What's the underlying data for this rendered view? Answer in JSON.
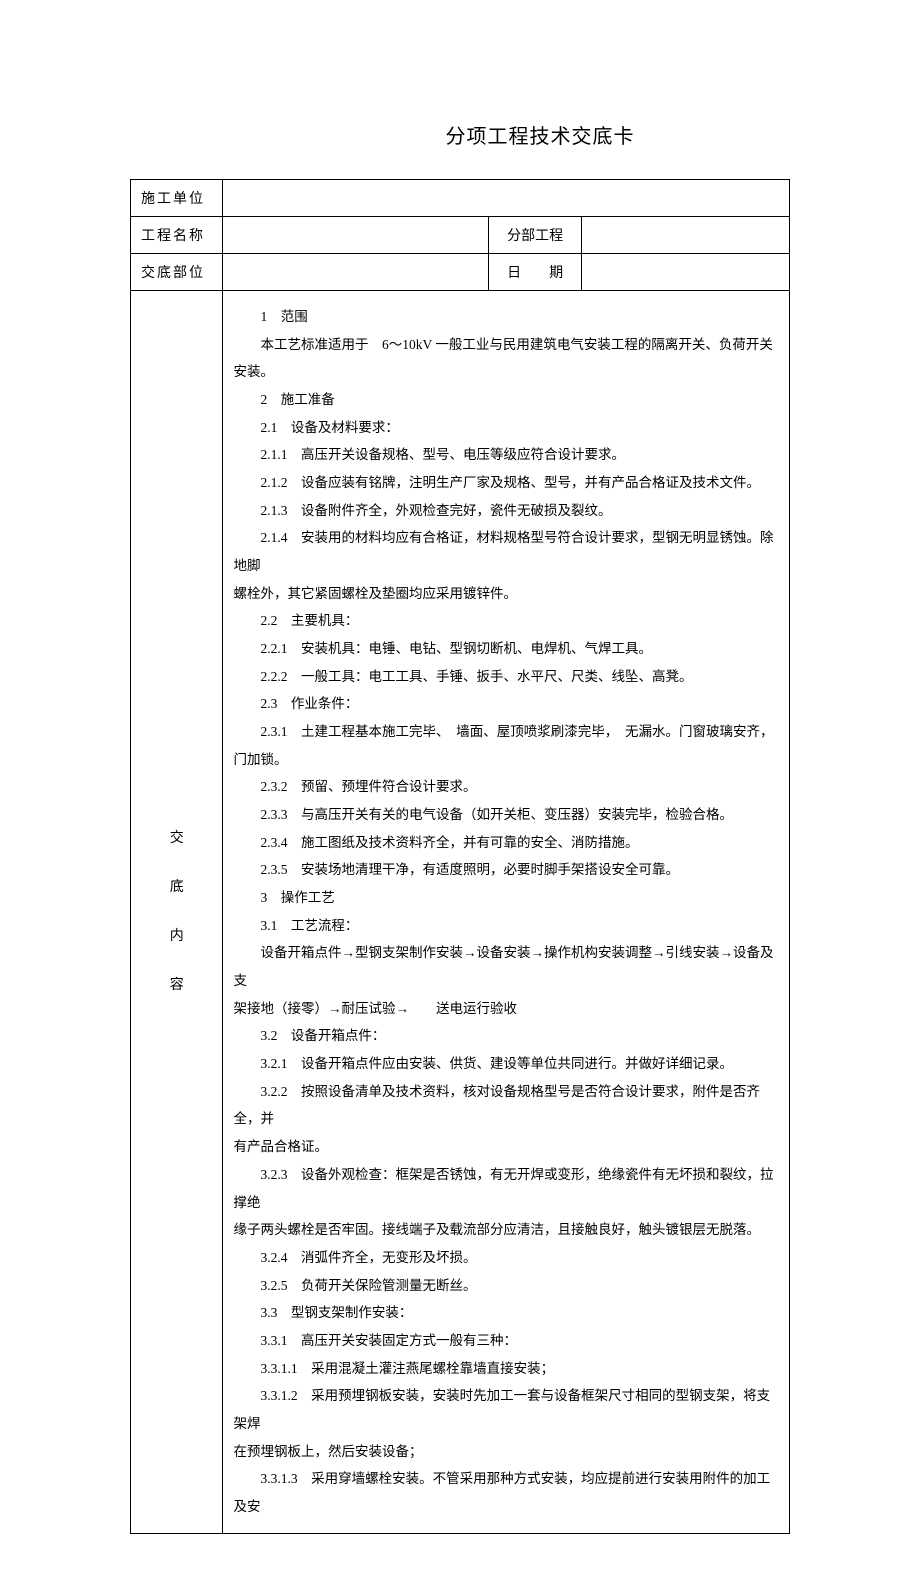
{
  "title": "分项工程技术交底卡",
  "header": {
    "row1_label": "施工单位",
    "row1_value": "",
    "row2_label": "工程名称",
    "row2_value": "",
    "row2_label2": "分部工程",
    "row2_value2": "",
    "row3_label": "交底部位",
    "row3_value": "",
    "row3_label2": "日　　期",
    "row3_value2": ""
  },
  "side": {
    "c1": "交",
    "c2": "底",
    "c3": "内",
    "c4": "容"
  },
  "body": {
    "p1": "1　范围",
    "p2": "本工艺标准适用于　6～10kV 一般工业与民用建筑电气安装工程的隔离开关、负荷开关安装。",
    "p3": "2　施工准备",
    "p4": "2.1　设备及材料要求：",
    "p5": "2.1.1　高压开关设备规格、型号、电压等级应符合设计要求。",
    "p6": "2.1.2　设备应装有铭牌，注明生产厂家及规格、型号，并有产品合格证及技术文件。",
    "p7": "2.1.3　设备附件齐全，外观检查完好，瓷件无破损及裂纹。",
    "p8a": "2.1.4　安装用的材料均应有合格证，材料规格型号符合设计要求，型钢无明显锈蚀。除地脚",
    "p8b": "螺栓外，其它紧固螺栓及垫圈均应采用镀锌件。",
    "p9": "2.2　主要机具：",
    "p10": "2.2.1　安装机具：电锤、电钻、型钢切断机、电焊机、气焊工具。",
    "p11": "2.2.2　一般工具：电工工具、手锤、扳手、水平尺、尺类、线坠、高凳。",
    "p12": "2.3　作业条件：",
    "p13": "2.3.1　土建工程基本施工完毕、　墙面、屋顶喷浆刷漆完毕，　无漏水。门窗玻璃安齐，　门加锁。",
    "p14": "2.3.2　预留、预埋件符合设计要求。",
    "p15": "2.3.3　与高压开关有关的电气设备（如开关柜、变压器）安装完毕，检验合格。",
    "p16": "2.3.4　施工图纸及技术资料齐全，并有可靠的安全、消防措施。",
    "p17": "2.3.5　安装场地清理干净，有适度照明，必要时脚手架搭设安全可靠。",
    "p18": "3　操作工艺",
    "p19": "3.1　工艺流程：",
    "p20a": "设备开箱点件→型钢支架制作安装→设备安装→操作机构安装调整→引线安装→设备及支",
    "p20b": "架接地（接零）→耐压试验→　　送电运行验收",
    "p21": "3.2　设备开箱点件：",
    "p22": "3.2.1　设备开箱点件应由安装、供货、建设等单位共同进行。并做好详细记录。",
    "p23a": "3.2.2　按照设备清单及技术资料，核对设备规格型号是否符合设计要求，附件是否齐全，并",
    "p23b": "有产品合格证。",
    "p24a": "3.2.3　设备外观检查：框架是否锈蚀，有无开焊或变形，绝缘瓷件有无坏损和裂纹，拉撑绝",
    "p24b": "缘子两头螺栓是否牢固。接线端子及载流部分应清洁，且接触良好，触头镀银层无脱落。",
    "p25": "3.2.4　消弧件齐全，无变形及坏损。",
    "p26": "3.2.5　负荷开关保险管测量无断丝。",
    "p27": "3.3　型钢支架制作安装：",
    "p28": "3.3.1　高压开关安装固定方式一般有三种：",
    "p29": "3.3.1.1　采用混凝土灌注燕尾螺栓靠墙直接安装；",
    "p30a": "3.3.1.2　采用预埋钢板安装，安装时先加工一套与设备框架尺寸相同的型钢支架，将支架焊",
    "p30b": "在预埋钢板上，然后安装设备；",
    "p31": "3.3.1.3　采用穿墙螺栓安装。不管采用那种方式安装，均应提前进行安装用附件的加工及安"
  }
}
